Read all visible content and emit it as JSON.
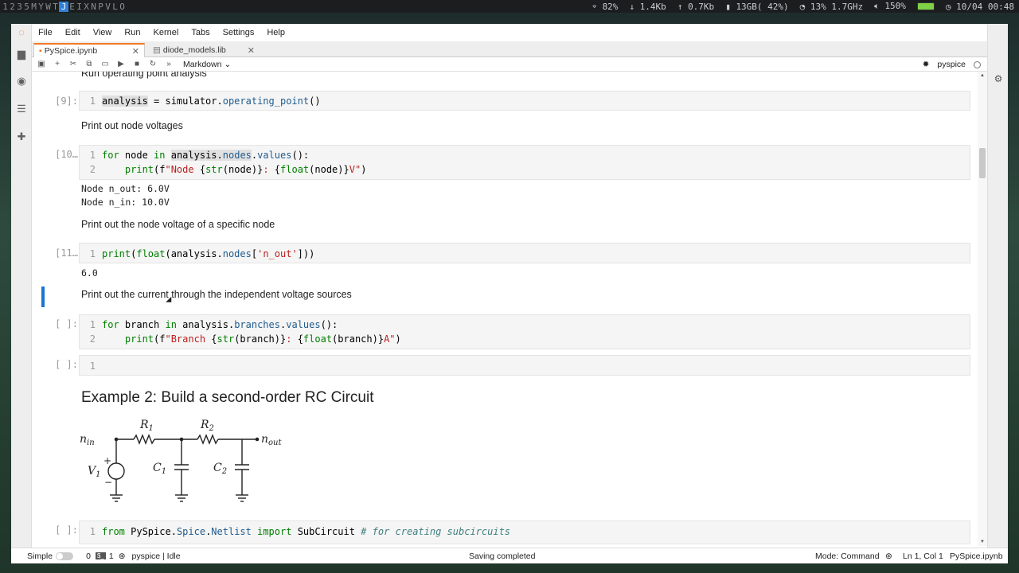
{
  "sysbar": {
    "workspaces": [
      "1",
      "2",
      "3",
      "5",
      "M",
      "Y",
      "W",
      "T",
      "J",
      "E",
      "I",
      "X",
      "N",
      "P",
      "V",
      "L",
      "O"
    ],
    "active_workspace": "J",
    "wifi": "82%",
    "down": "1.4Kb",
    "up": "0.7Kb",
    "mem": "13GB( 42%)",
    "cpu": "13% 1.7GHz",
    "volume": "150%",
    "datetime": "10/04 00:48"
  },
  "menu": [
    "File",
    "Edit",
    "View",
    "Run",
    "Kernel",
    "Tabs",
    "Settings",
    "Help"
  ],
  "tabs": [
    {
      "label": "PySpice.ipynb"
    },
    {
      "label": "diode_models.lib"
    }
  ],
  "toolbar": {
    "cell_type": "Markdown",
    "kernel_name": "pyspice"
  },
  "cells": {
    "md_run": "Run operating point analysis",
    "c9_prompt": "[9]:",
    "c9_line1_var": "analysis",
    "c9_line1_rest": " = simulator.",
    "c9_line1_fn": "operating_point",
    "c9_line1_end": "()",
    "md_print_nodes": "Print out node voltages",
    "c10_prompt": "[10…",
    "out10": [
      "Node n_out: 6.0V",
      "Node n_in: 10.0V"
    ],
    "md_specific": "Print out the node voltage of a specific node",
    "c11_prompt": "[11…",
    "out11": "6.0",
    "md_current": "Print out the current through the independent voltage sources",
    "c12_prompt": "[ ]:",
    "c13_prompt": "[ ]:",
    "heading": "Example 2: Build a second-order RC Circuit",
    "c14_prompt": "[ ]:",
    "c14_comment": "# for creating subcircuits"
  },
  "statusbar": {
    "mode_label": "Simple",
    "count0": "0",
    "count1": "1",
    "kernel_status": "pyspice | Idle",
    "saving": "Saving completed",
    "mode": "Mode: Command",
    "position": "Ln 1, Col 1",
    "file": "PySpice.ipynb"
  }
}
